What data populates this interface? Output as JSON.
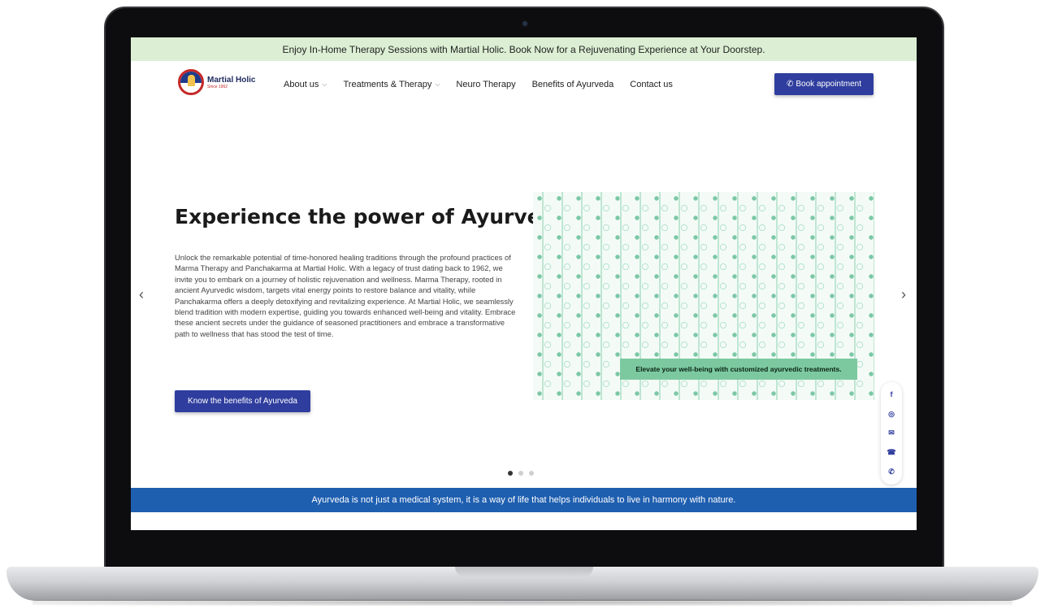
{
  "promo": {
    "text": "Enjoy In-Home Therapy Sessions with Martial Holic. Book Now for a Rejuvenating Experience at Your Doorstep."
  },
  "brand": {
    "name": "Martial Holic",
    "tagline": "Since 1962"
  },
  "nav": {
    "items": [
      {
        "label": "About us",
        "has_dropdown": true
      },
      {
        "label": "Treatments & Therapy",
        "has_dropdown": true
      },
      {
        "label": "Neuro Therapy",
        "has_dropdown": false
      },
      {
        "label": "Benefits of Ayurveda",
        "has_dropdown": false
      },
      {
        "label": "Contact us",
        "has_dropdown": false
      }
    ],
    "book_button": "Book appointment"
  },
  "hero": {
    "title": "Experience the power of Ayurveda",
    "description": "Unlock the remarkable potential of time-honored healing traditions through the profound practices of Marma Therapy and Panchakarma at Martial Holic. With a legacy of trust dating back to 1962, we invite you to embark on a journey of holistic rejuvenation and wellness. Marma Therapy, rooted in ancient Ayurvedic wisdom, targets vital energy points to restore balance and vitality, while Panchakarma offers a deeply detoxifying and revitalizing experience. At Martial Holic, we seamlessly blend tradition with modern expertise, guiding you towards enhanced well-being and vitality. Embrace these ancient secrets under the guidance of seasoned practitioners and embrace a transformative path to wellness that has stood the test of time.",
    "button": "Know the benefits of Ayurveda",
    "image_caption": "Elevate your well-being with customized ayurvedic treatments."
  },
  "carousel": {
    "prev_glyph": "‹",
    "next_glyph": "›",
    "slides": 3,
    "active_index": 0
  },
  "social": [
    "facebook-icon",
    "instagram-icon",
    "email-icon",
    "phone-icon",
    "whatsapp-icon"
  ],
  "quote": {
    "text": "Ayurveda is not just a medical system, it is a way of life that helps individuals to live in harmony with nature."
  },
  "colors": {
    "primary": "#2f3e9e",
    "promo_bg": "#dcefd4",
    "quote_bg": "#1f5fb0",
    "caption_bg": "#7cc9a0",
    "logo_red": "#c62828"
  }
}
